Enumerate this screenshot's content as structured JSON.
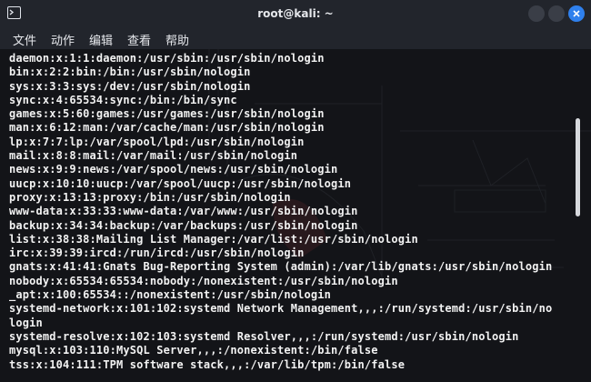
{
  "window": {
    "title": "root@kali: ~"
  },
  "menu": {
    "items": [
      "文件",
      "动作",
      "编辑",
      "查看",
      "帮助"
    ]
  },
  "icons": {
    "app": "terminal-icon",
    "minimize": "minimize-icon",
    "maximize": "maximize-icon",
    "close": "close-icon"
  },
  "colors": {
    "close_button": "#2f80ed",
    "background": "#131418",
    "text": "#f2f2f2"
  },
  "terminal": {
    "lines": [
      "daemon:x:1:1:daemon:/usr/sbin:/usr/sbin/nologin",
      "bin:x:2:2:bin:/bin:/usr/sbin/nologin",
      "sys:x:3:3:sys:/dev:/usr/sbin/nologin",
      "sync:x:4:65534:sync:/bin:/bin/sync",
      "games:x:5:60:games:/usr/games:/usr/sbin/nologin",
      "man:x:6:12:man:/var/cache/man:/usr/sbin/nologin",
      "lp:x:7:7:lp:/var/spool/lpd:/usr/sbin/nologin",
      "mail:x:8:8:mail:/var/mail:/usr/sbin/nologin",
      "news:x:9:9:news:/var/spool/news:/usr/sbin/nologin",
      "uucp:x:10:10:uucp:/var/spool/uucp:/usr/sbin/nologin",
      "proxy:x:13:13:proxy:/bin:/usr/sbin/nologin",
      "www-data:x:33:33:www-data:/var/www:/usr/sbin/nologin",
      "backup:x:34:34:backup:/var/backups:/usr/sbin/nologin",
      "list:x:38:38:Mailing List Manager:/var/list:/usr/sbin/nologin",
      "irc:x:39:39:ircd:/run/ircd:/usr/sbin/nologin",
      "gnats:x:41:41:Gnats Bug-Reporting System (admin):/var/lib/gnats:/usr/sbin/nologin",
      "nobody:x:65534:65534:nobody:/nonexistent:/usr/sbin/nologin",
      "_apt:x:100:65534::/nonexistent:/usr/sbin/nologin",
      "systemd-network:x:101:102:systemd Network Management,,,:/run/systemd:/usr/sbin/no",
      "login",
      "systemd-resolve:x:102:103:systemd Resolver,,,:/run/systemd:/usr/sbin/nologin",
      "mysql:x:103:110:MySQL Server,,,:/nonexistent:/bin/false",
      "tss:x:104:111:TPM software stack,,,:/var/lib/tpm:/bin/false"
    ]
  }
}
